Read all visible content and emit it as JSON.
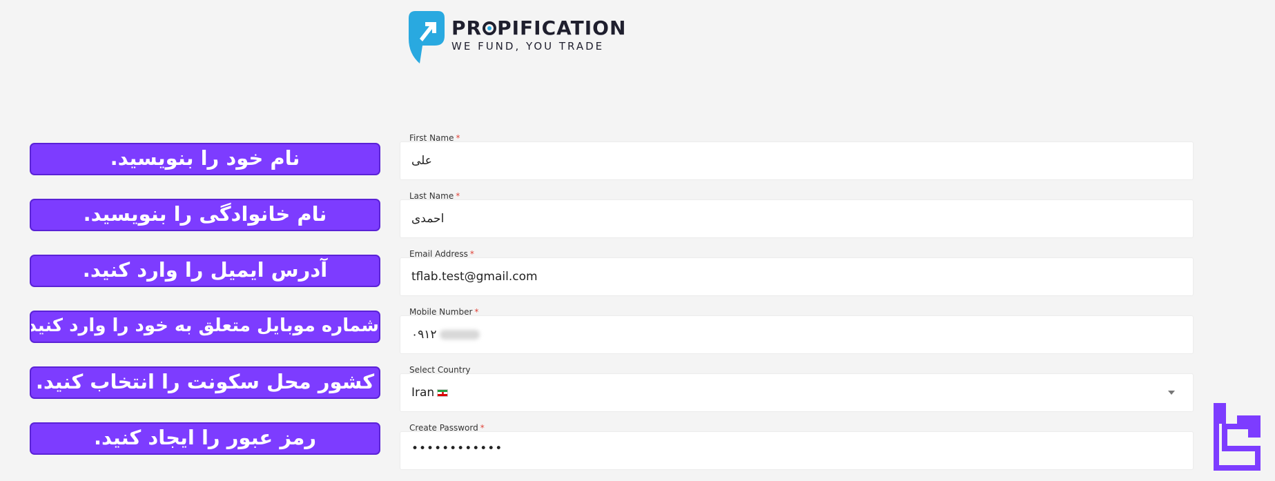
{
  "logo": {
    "name_part1": "PR",
    "name_part2": "PIFICATION",
    "tagline": "WE FUND, YOU TRADE"
  },
  "instructions": [
    "نام خود را بنویسید.",
    "نام خانوادگی را بنویسید.",
    "آدرس ایمیل را وارد کنید.",
    "شماره موبایل متعلق به خود را وارد کنید.",
    "کشور محل سکونت را انتخاب کنید.",
    "رمز عبور را ایجاد کنید."
  ],
  "form": {
    "first_name": {
      "label": "First Name",
      "required": "*",
      "value": "علی"
    },
    "last_name": {
      "label": "Last Name",
      "required": "*",
      "value": "احمدی"
    },
    "email": {
      "label": "Email Address",
      "required": "*",
      "value": "tflab.test@gmail.com"
    },
    "mobile": {
      "label": "Mobile Number",
      "required": "*",
      "value": "۰۹۱۲"
    },
    "country": {
      "label": "Select Country",
      "value": "Iran"
    },
    "password": {
      "label": "Create Password",
      "required": "*",
      "value": "••••••••••••"
    }
  },
  "colors": {
    "instruction_bg": "#7d3cff",
    "logo_accent": "#29a9e0",
    "brand_mark": "#7d3cff",
    "page_bg": "#f4f4f4"
  },
  "icons": {
    "logo": "propification-arrow-logo",
    "country_flag": "iran-flag-icon",
    "dropdown": "chevron-down-icon",
    "brand_mark": "tflab-logo-icon"
  }
}
